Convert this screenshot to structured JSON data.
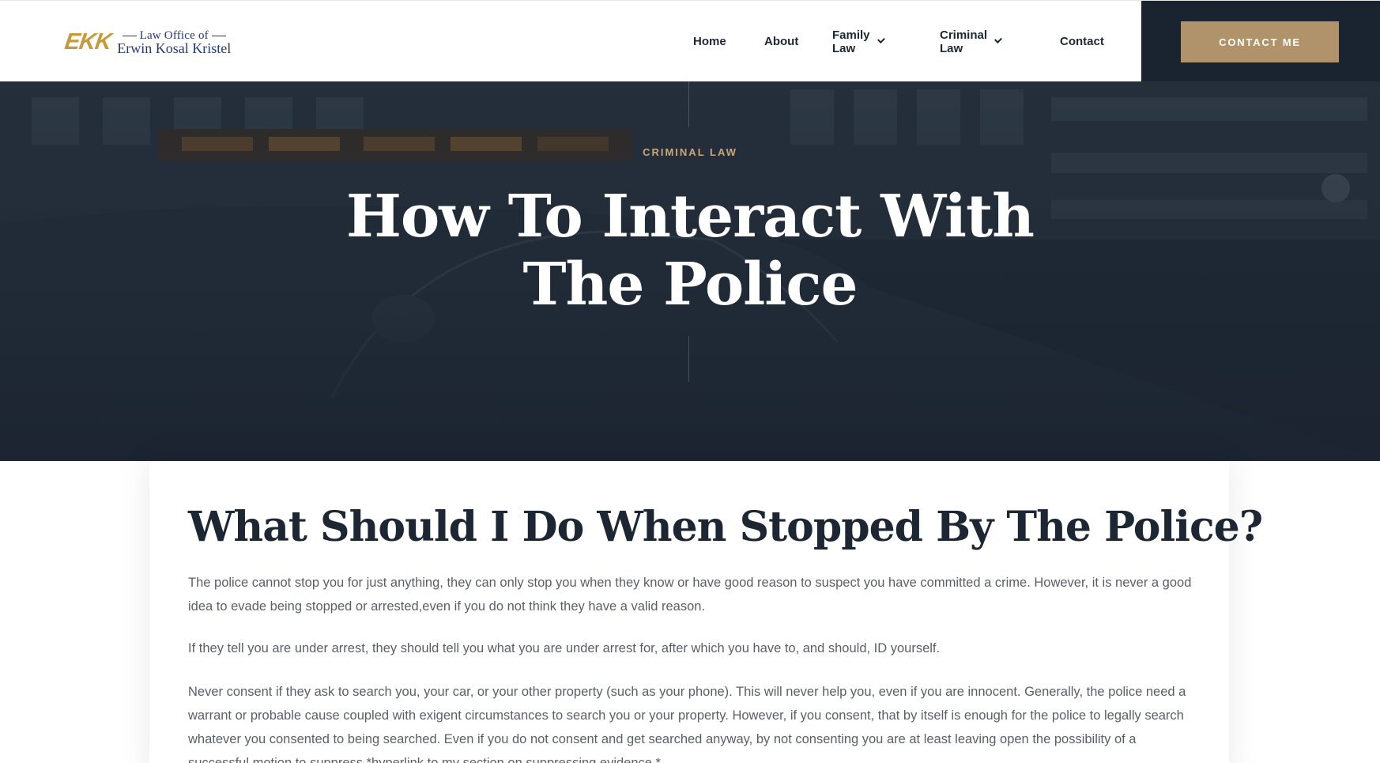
{
  "header": {
    "logo": {
      "mark": "EKK",
      "line1": "Law Office of",
      "line2": "Erwin Kosal Kristel"
    },
    "nav": [
      {
        "label": "Home",
        "has_dropdown": false
      },
      {
        "label": "About",
        "has_dropdown": false
      },
      {
        "label": "Family Law",
        "has_dropdown": true
      },
      {
        "label": "Criminal Law",
        "has_dropdown": true
      },
      {
        "label": "Contact",
        "has_dropdown": false
      }
    ],
    "cta_label": "CONTACT ME"
  },
  "hero": {
    "kicker": "CRIMINAL LAW",
    "title": "How To Interact With The Police"
  },
  "article": {
    "heading": "What Should I Do When Stopped By The Police?",
    "paragraphs": [
      "The police cannot stop you for just anything, they can only stop you when they know or have good reason to suspect you have committed a crime. However, it is never a good idea to evade being stopped or arrested,even if you do not think they have a valid reason.",
      "If they tell you are under arrest, they should tell you what you are under arrest for, after which you have to, and should, ID yourself.",
      "Never consent if they ask to search you, your car, or your other property (such as your phone). This will never help you, even if you are innocent. Generally, the police need a warrant or probable cause coupled with exigent circumstances to search you or your property. However, if you consent, that by itself is enough for the police to legally search whatever you consented to being searched. Even if you do not consent and get searched anyway, by not consenting you are at least leaving open the possibility of a successful motion to suppress *hyperlink to my section on suppressing evidence.*"
    ]
  },
  "colors": {
    "navy": "#1a2431",
    "gold": "#b0936a",
    "kicker_gold": "#c9a77a",
    "logo_gold": "#c79a3c",
    "logo_blue": "#243a78",
    "body_text": "#5a5f66"
  },
  "icons": {
    "dropdown": "chevron-down-icon"
  }
}
